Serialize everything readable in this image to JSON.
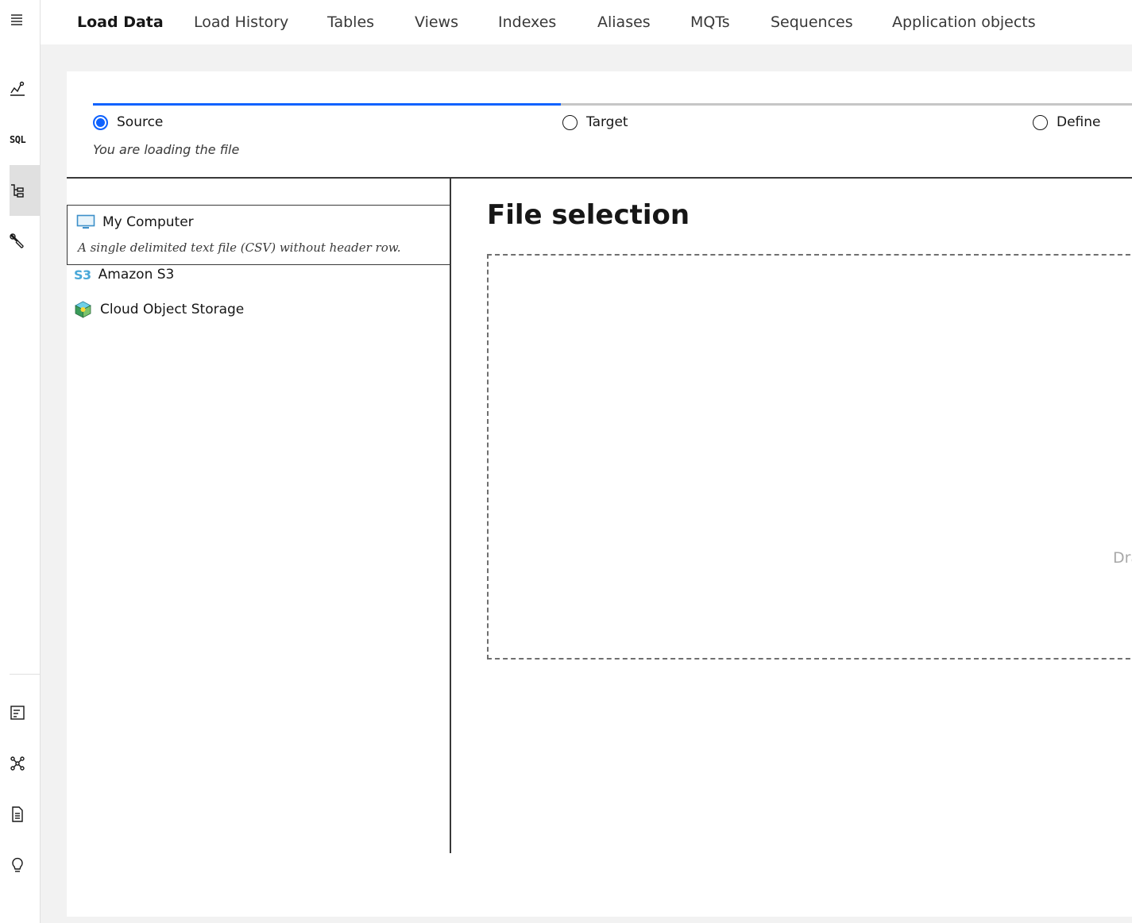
{
  "nav": {
    "tabs": [
      {
        "label": "Load Data",
        "active": true
      },
      {
        "label": "Load History",
        "active": false
      },
      {
        "label": "Tables",
        "active": false
      },
      {
        "label": "Views",
        "active": false
      },
      {
        "label": "Indexes",
        "active": false
      },
      {
        "label": "Aliases",
        "active": false
      },
      {
        "label": "MQTs",
        "active": false
      },
      {
        "label": "Sequences",
        "active": false
      },
      {
        "label": "Application objects",
        "active": false
      }
    ]
  },
  "rail": {
    "sql_label": "SQL",
    "items": [
      "menu-icon",
      "monitor-chart-icon",
      "sql-icon",
      "data-tree-icon",
      "wrench-icon",
      "log-icon",
      "network-icon",
      "document-icon",
      "lightbulb-icon"
    ],
    "active_item": "data-tree-icon"
  },
  "progress": {
    "steps": [
      {
        "label": "Source",
        "state": "current"
      },
      {
        "label": "Target",
        "state": "incomplete"
      },
      {
        "label": "Define",
        "state": "incomplete"
      }
    ],
    "description": "You are loading the file",
    "fraction_complete": 0.45
  },
  "sources": {
    "items": [
      {
        "name": "My Computer",
        "description": "A single delimited text file (CSV) without header row.",
        "icon": "computer-icon",
        "selected": true
      },
      {
        "name": "Amazon S3",
        "icon_text": "S3",
        "icon": "s3-icon",
        "selected": false
      },
      {
        "name": "Cloud Object Storage",
        "icon": "cloud-object-storage-icon",
        "selected": false
      }
    ]
  },
  "file_selection": {
    "title": "File selection",
    "drop_hint": "Dra"
  },
  "colors": {
    "accent": "#0f62fe",
    "background": "#f2f2f2",
    "surface": "#ffffff",
    "s3": "#4aa8d8"
  }
}
